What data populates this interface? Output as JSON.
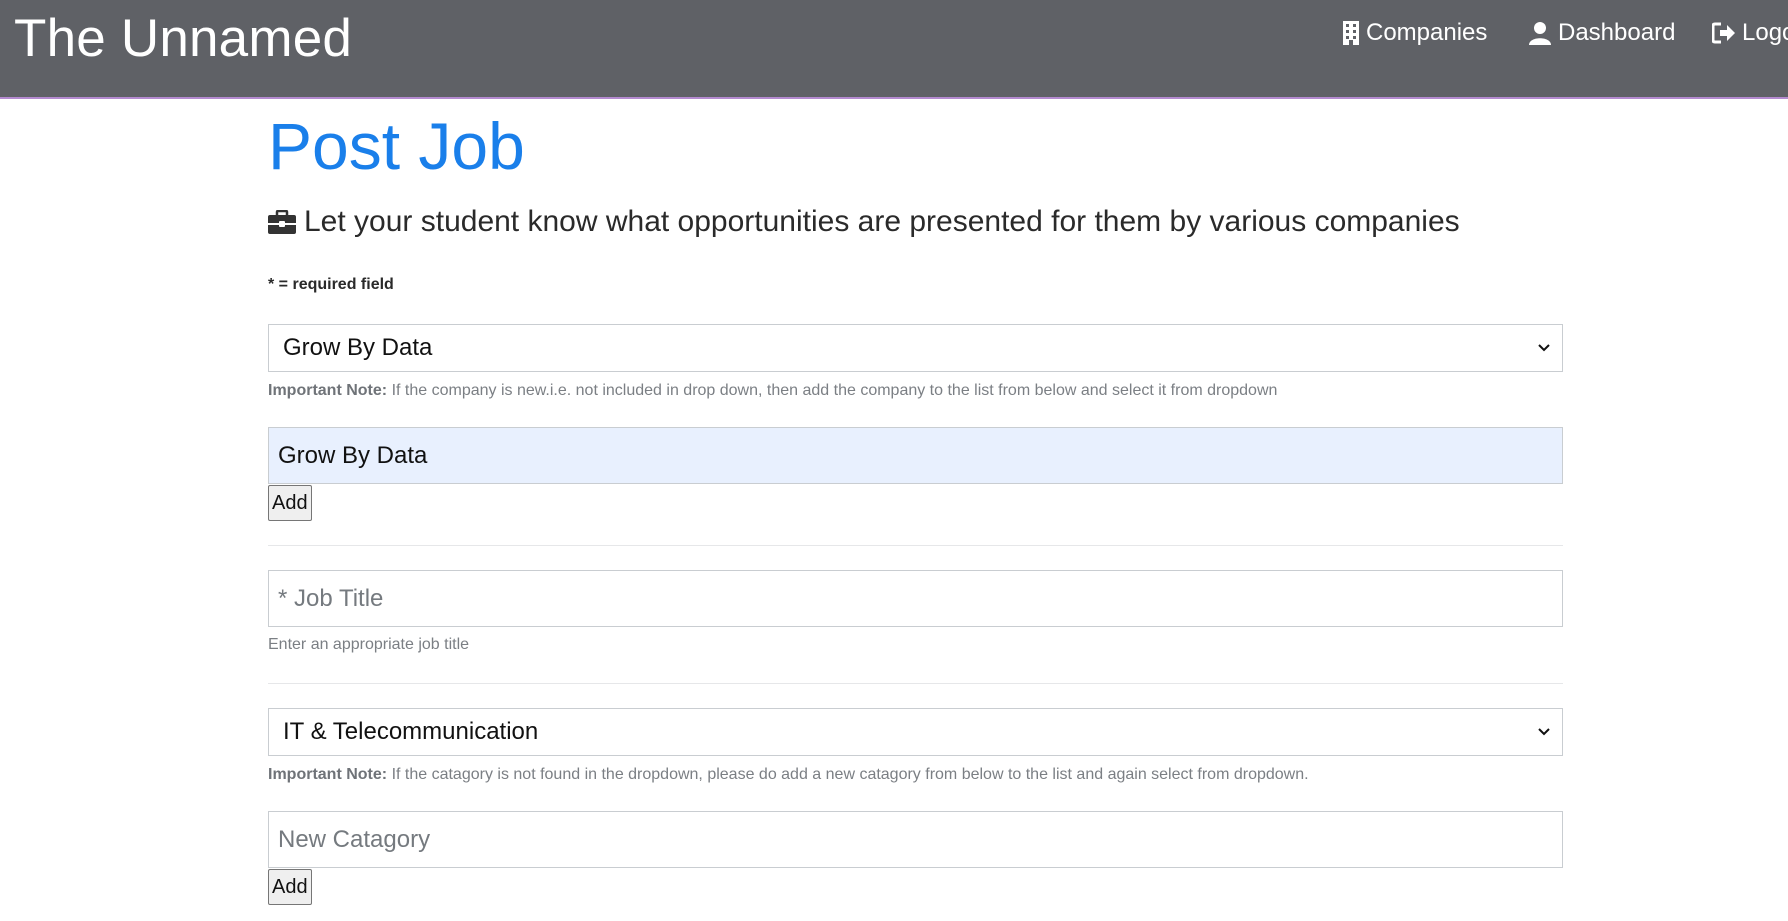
{
  "navbar": {
    "brand": "The Unnamed",
    "items": [
      {
        "label": "Companies",
        "icon": "building-icon"
      },
      {
        "label": "Dashboard",
        "icon": "user-icon"
      },
      {
        "label": "Logout",
        "icon": "sign-out-icon"
      }
    ],
    "background": "#5f6166",
    "accent_border": "#b48ad0"
  },
  "page": {
    "title": "Post Job",
    "title_color": "#1a7fea",
    "lead_icon": "briefcase-icon",
    "lead": "Let your student know what opportunities are presented for them by various companies",
    "required_note": "* = required field"
  },
  "form": {
    "company_select": {
      "value": "Grow By Data"
    },
    "company_note": {
      "label": "Important Note:",
      "text": "If the company is new.i.e. not included in drop down, then add the company to the list from below and select it from dropdown"
    },
    "new_company": {
      "value": "Grow By Data"
    },
    "add_company_button": "Add",
    "job_title": {
      "placeholder": "* Job Title",
      "value": "",
      "help": "Enter an appropriate job title"
    },
    "category_select": {
      "value": "IT & Telecommunication"
    },
    "category_note": {
      "label": "Important Note:",
      "text": "If the catagory is not found in the dropdown, please do add a new catagory from below to the list and again select from dropdown."
    },
    "new_category": {
      "placeholder": "New Catagory",
      "value": ""
    },
    "add_category_button": "Add"
  }
}
